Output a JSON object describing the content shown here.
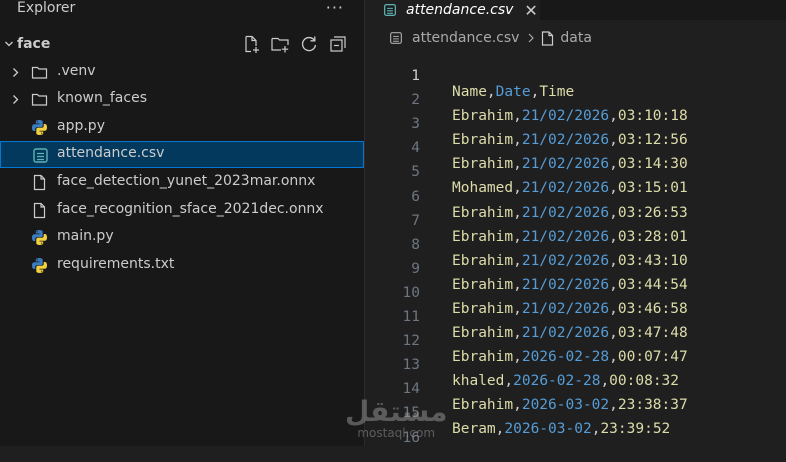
{
  "explorer": {
    "title": "Explorer",
    "more_icon": "more-icon",
    "folder": {
      "name": "face",
      "expanded": true
    },
    "actions": [
      "new-file-icon",
      "new-folder-icon",
      "refresh-icon",
      "collapse-all-icon"
    ],
    "items": [
      {
        "label": ".venv",
        "type": "folder",
        "icon": "folder-icon"
      },
      {
        "label": "known_faces",
        "type": "folder",
        "icon": "folder-icon"
      },
      {
        "label": "app.py",
        "type": "python",
        "icon": "python-icon"
      },
      {
        "label": "attendance.csv",
        "type": "csv",
        "icon": "csv-icon",
        "selected": true
      },
      {
        "label": "face_detection_yunet_2023mar.onnx",
        "type": "file",
        "icon": "file-icon"
      },
      {
        "label": "face_recognition_sface_2021dec.onnx",
        "type": "file",
        "icon": "file-icon"
      },
      {
        "label": "main.py",
        "type": "python",
        "icon": "python-icon"
      },
      {
        "label": "requirements.txt",
        "type": "file",
        "icon": "file-icon"
      }
    ]
  },
  "editor": {
    "tab": {
      "label": "attendance.csv",
      "close_icon": "close-icon"
    },
    "breadcrumb": {
      "file": "attendance.csv",
      "symbol": "data"
    },
    "lines": [
      {
        "n": "1",
        "name": "Name",
        "date": "Date",
        "time": "Time"
      },
      {
        "n": "2",
        "name": "Ebrahim",
        "date": "21/02/2026",
        "time": "03:10:18"
      },
      {
        "n": "3",
        "name": "Ebrahim",
        "date": "21/02/2026",
        "time": "03:12:56"
      },
      {
        "n": "4",
        "name": "Ebrahim",
        "date": "21/02/2026",
        "time": "03:14:30"
      },
      {
        "n": "5",
        "name": "Mohamed",
        "date": "21/02/2026",
        "time": "03:15:01"
      },
      {
        "n": "6",
        "name": "Ebrahim",
        "date": "21/02/2026",
        "time": "03:26:53"
      },
      {
        "n": "7",
        "name": "Ebrahim",
        "date": "21/02/2026",
        "time": "03:28:01"
      },
      {
        "n": "8",
        "name": "Ebrahim",
        "date": "21/02/2026",
        "time": "03:43:10"
      },
      {
        "n": "9",
        "name": "Ebrahim",
        "date": "21/02/2026",
        "time": "03:44:54"
      },
      {
        "n": "10",
        "name": "Ebrahim",
        "date": "21/02/2026",
        "time": "03:46:58"
      },
      {
        "n": "11",
        "name": "Ebrahim",
        "date": "21/02/2026",
        "time": "03:47:48"
      },
      {
        "n": "12",
        "name": "Ebrahim",
        "date": "2026-02-28",
        "time": "00:07:47"
      },
      {
        "n": "13",
        "name": "khaled",
        "date": "2026-02-28",
        "time": "00:08:32"
      },
      {
        "n": "14",
        "name": "Ebrahim",
        "date": "2026-03-02",
        "time": "23:38:37"
      },
      {
        "n": "15",
        "name": "Beram",
        "date": "2026-03-02",
        "time": "23:39:52"
      },
      {
        "n": "16",
        "name": "",
        "date": "",
        "time": ""
      }
    ]
  },
  "watermark": {
    "logo": "مستقل",
    "site": "mostaql.com"
  },
  "colors": {
    "name": "#dcdcaa",
    "date": "#569cd6",
    "time": "#dcdcaa",
    "selection_bg": "#04395e",
    "selection_border": "#0078d4",
    "python_blue": "#3b7bbf",
    "python_yellow": "#f3d03e",
    "csv_teal": "#5fb3b3"
  }
}
